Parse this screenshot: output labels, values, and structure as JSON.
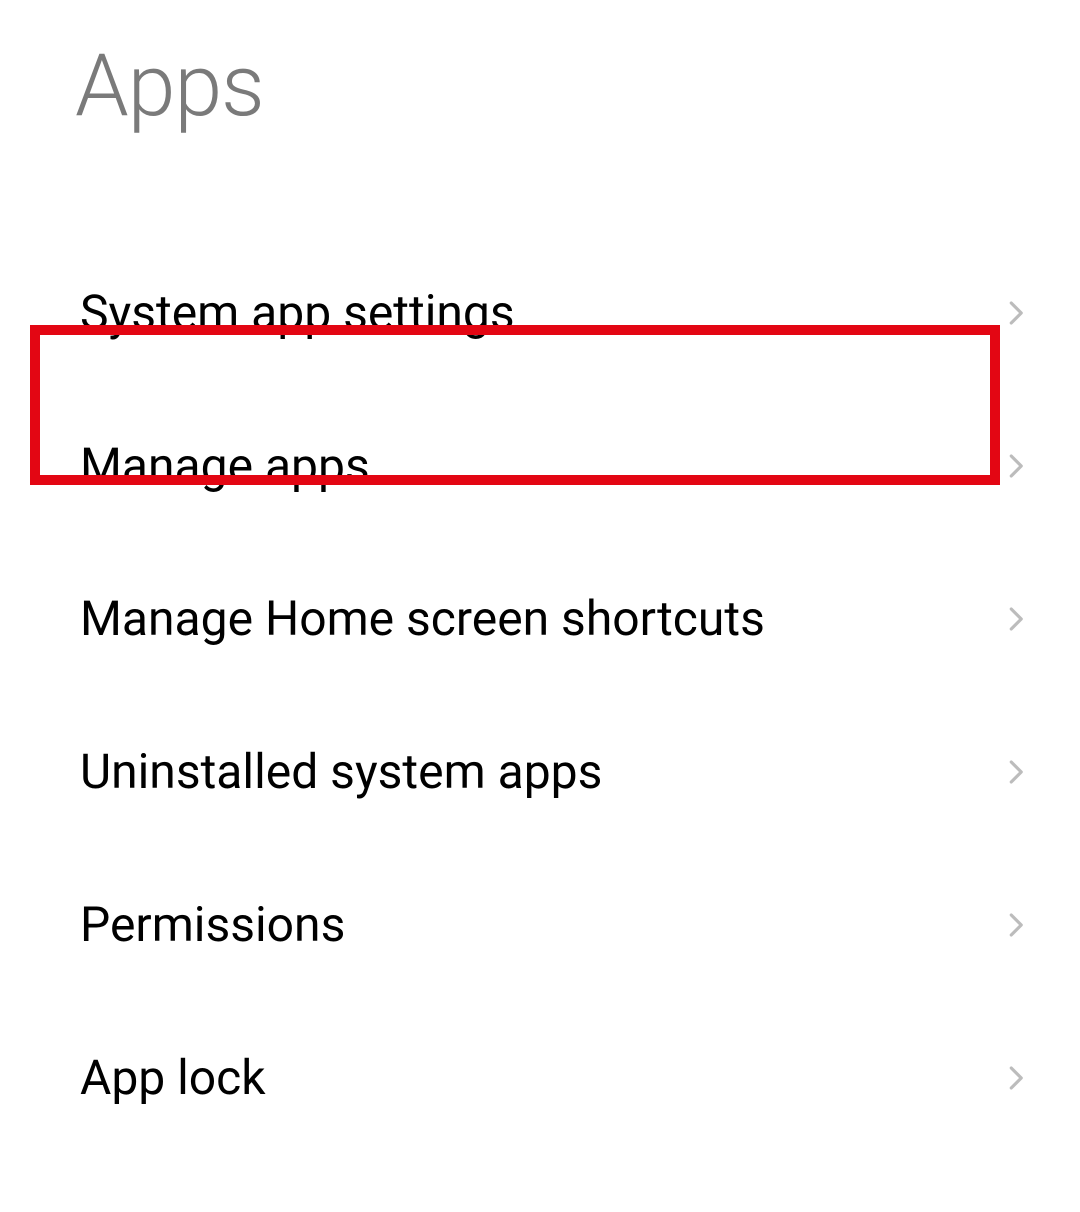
{
  "page": {
    "title": "Apps"
  },
  "settings": {
    "items": [
      {
        "label": "System app settings"
      },
      {
        "label": "Manage apps"
      },
      {
        "label": "Manage Home screen shortcuts"
      },
      {
        "label": "Uninstalled system apps"
      },
      {
        "label": "Permissions"
      },
      {
        "label": "App lock"
      }
    ]
  },
  "highlighted_index": 1
}
